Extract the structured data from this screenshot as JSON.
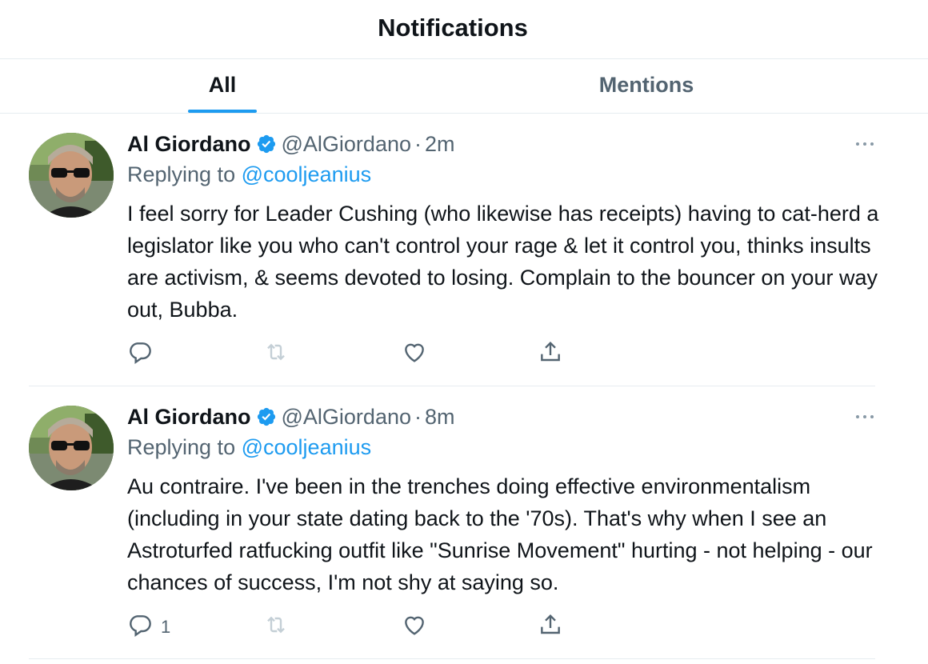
{
  "header": {
    "title": "Notifications"
  },
  "tabs": [
    {
      "label": "All",
      "active": true
    },
    {
      "label": "Mentions",
      "active": false
    }
  ],
  "colors": {
    "accent": "#1d9bf0",
    "secondary_text": "#536471",
    "primary_text": "#0f1419",
    "divider": "#e6ecf0"
  },
  "tweets": [
    {
      "display_name": "Al Giordano",
      "handle": "@AlGiordano",
      "separator": "·",
      "time": "2m",
      "replying_prefix": "Replying to",
      "replying_to": "@cooljeanius",
      "text": "I feel sorry for Leader Cushing (who likewise has receipts) having to cat-herd a legislator like you who can't control your rage & let it control you, thinks insults are activism, & seems devoted to losing. Complain to the bouncer on your way out, Bubba.",
      "reply_count": "",
      "icons": [
        "reply-icon",
        "retweet-icon",
        "like-icon",
        "share-icon"
      ]
    },
    {
      "display_name": "Al Giordano",
      "handle": "@AlGiordano",
      "separator": "·",
      "time": "8m",
      "replying_prefix": "Replying to",
      "replying_to": "@cooljeanius",
      "text": "Au contraire. I've been in the trenches doing effective environmentalism (including in your state dating back to the '70s). That's why when I see an Astroturfed ratfucking outfit like \"Sunrise Movement\" hurting - not helping - our chances of success, I'm not shy at saying so.",
      "reply_count": "1",
      "icons": [
        "reply-icon",
        "retweet-icon",
        "like-icon",
        "share-icon"
      ]
    }
  ]
}
